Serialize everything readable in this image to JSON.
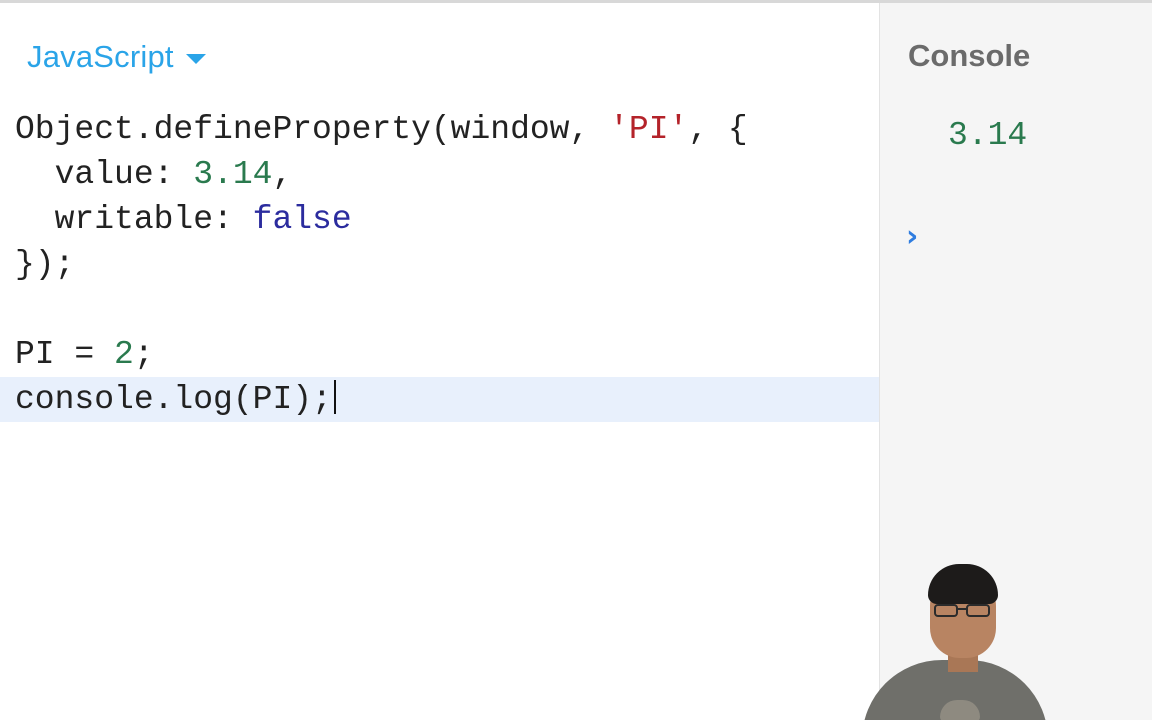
{
  "editor": {
    "language": "JavaScript",
    "code_lines": [
      [
        {
          "t": "Object.defineProperty(window, ",
          "c": "plain"
        },
        {
          "t": "'PI'",
          "c": "str"
        },
        {
          "t": ", {",
          "c": "plain"
        }
      ],
      [
        {
          "t": "  value: ",
          "c": "plain"
        },
        {
          "t": "3.14",
          "c": "num"
        },
        {
          "t": ",",
          "c": "plain"
        }
      ],
      [
        {
          "t": "  writable: ",
          "c": "plain"
        },
        {
          "t": "false",
          "c": "kw"
        }
      ],
      [
        {
          "t": "});",
          "c": "plain"
        }
      ],
      [],
      [
        {
          "t": "PI = ",
          "c": "plain"
        },
        {
          "t": "2",
          "c": "num"
        },
        {
          "t": ";",
          "c": "plain"
        }
      ],
      [
        {
          "t": "console.log(PI);",
          "c": "plain"
        }
      ]
    ],
    "active_line": 6
  },
  "console": {
    "title": "Console",
    "output": "3.14",
    "prompt_symbol": "›"
  },
  "colors": {
    "accent": "#2aa4e8",
    "string": "#b4232a",
    "number": "#2a7a4e",
    "keyword": "#2b2c9e",
    "prompt": "#2f7de0",
    "active_line_bg": "#e8f0fc"
  },
  "icons": {
    "language_dropdown": "caret-down-icon",
    "console_prompt": "chevron-right-icon"
  }
}
